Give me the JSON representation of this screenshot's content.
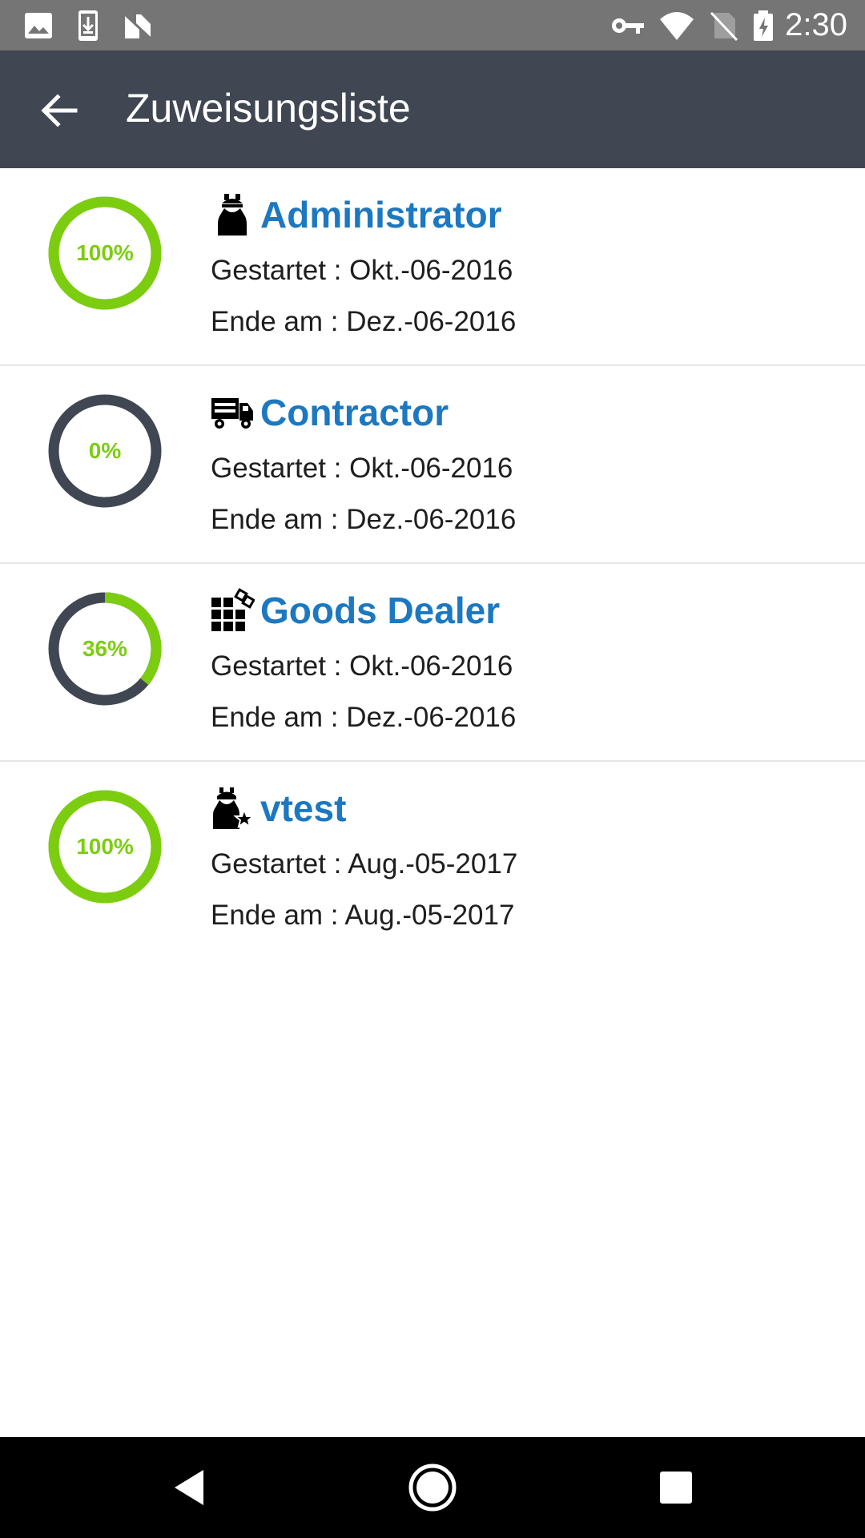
{
  "status_bar": {
    "time": "2:30",
    "icons": [
      "image-icon",
      "download-icon",
      "n-icon",
      "key-icon",
      "wifi-icon",
      "no-sim-icon",
      "battery-icon"
    ]
  },
  "app_bar": {
    "title": "Zuweisungsliste",
    "back_icon": "arrow-back-icon"
  },
  "colors": {
    "app_bar": "#404753",
    "accent_green": "#7ccd0f",
    "ring_track": "#404753",
    "role_blue": "#1c78c0"
  },
  "assignments": [
    {
      "role": "Administrator",
      "icon": "administrator-icon",
      "progress": 100,
      "progress_label": "100%",
      "started": "Gestartet : Okt.-06-2016",
      "ends": "Ende am : Dez.-06-2016"
    },
    {
      "role": "Contractor",
      "icon": "truck-icon",
      "progress": 0,
      "progress_label": "0%",
      "started": "Gestartet : Okt.-06-2016",
      "ends": "Ende am : Dez.-06-2016"
    },
    {
      "role": "Goods Dealer",
      "icon": "goods-icon",
      "progress": 36,
      "progress_label": "36%",
      "started": "Gestartet : Okt.-06-2016",
      "ends": "Ende am : Dez.-06-2016"
    },
    {
      "role": "vtest",
      "icon": "worker-star-icon",
      "progress": 100,
      "progress_label": "100%",
      "started": "Gestartet : Aug.-05-2017",
      "ends": "Ende am : Aug.-05-2017"
    }
  ],
  "nav_bar": {
    "buttons": [
      "back-nav-icon",
      "home-nav-icon",
      "recents-nav-icon"
    ]
  }
}
